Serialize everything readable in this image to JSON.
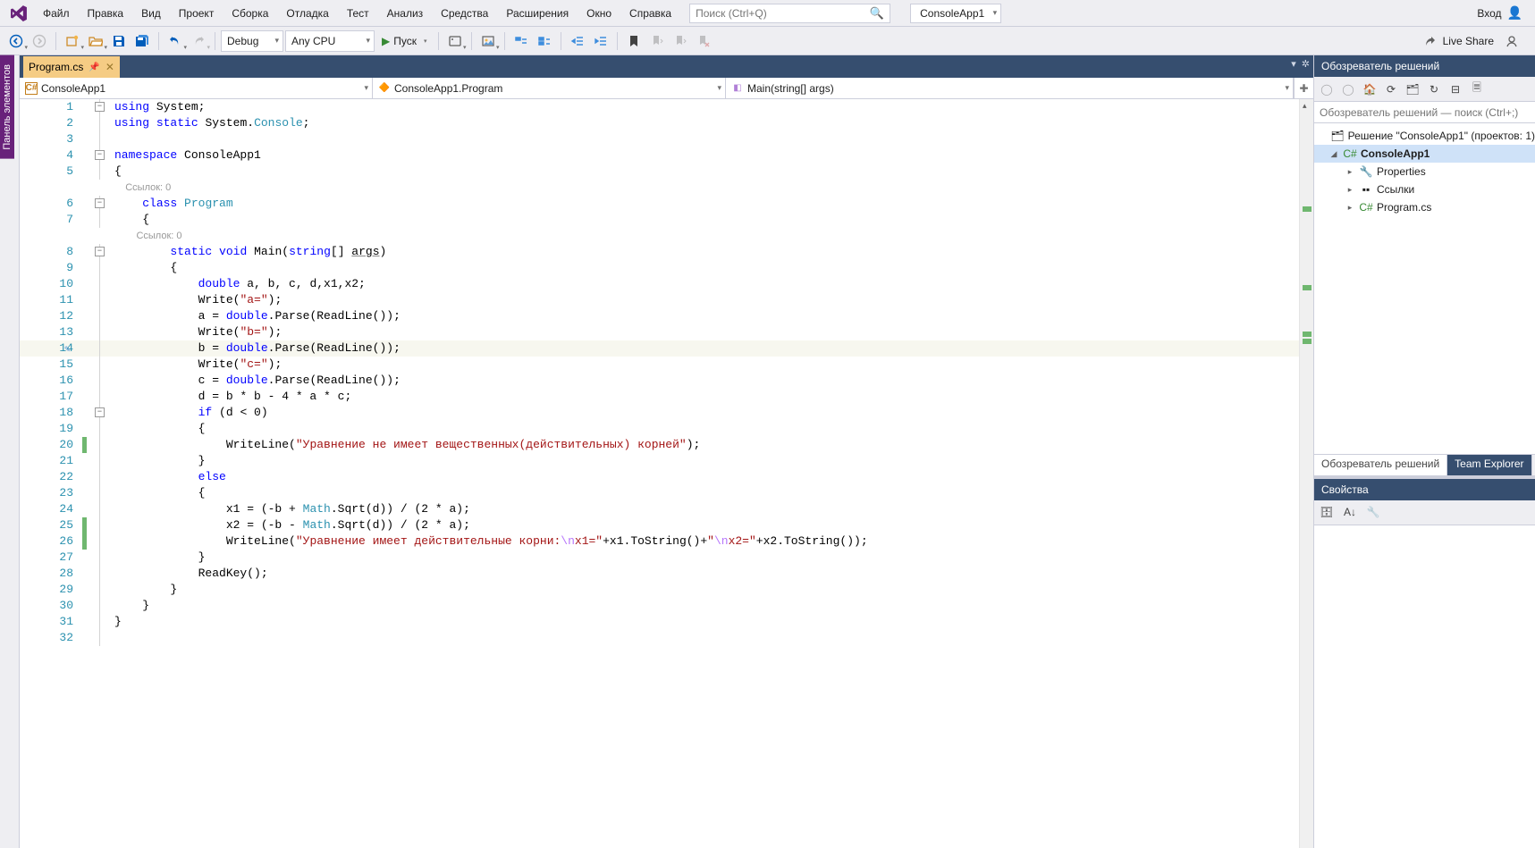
{
  "menubar": {
    "items": [
      "Файл",
      "Правка",
      "Вид",
      "Проект",
      "Сборка",
      "Отладка",
      "Тест",
      "Анализ",
      "Средства",
      "Расширения",
      "Окно",
      "Справка"
    ],
    "search_placeholder": "Поиск (Ctrl+Q)",
    "project_chip": "ConsoleApp1",
    "login": "Вход"
  },
  "toolbar": {
    "config": "Debug",
    "platform": "Any CPU",
    "start": "Пуск",
    "liveshare": "Live Share"
  },
  "left_panel": {
    "tab": "Панель элементов"
  },
  "document": {
    "tab": "Program.cs",
    "nav_project": "ConsoleApp1",
    "nav_class": "ConsoleApp1.Program",
    "nav_member": "Main(string[] args)"
  },
  "codelens": {
    "refs": "Ссылок: 0"
  },
  "code_lines": [
    {
      "n": 1,
      "fold": "-",
      "html": "<span class='kw'>using</span> System;"
    },
    {
      "n": 2,
      "html": "<span class='kw'>using</span> <span class='kw'>static</span> System.<span class='type'>Console</span>;"
    },
    {
      "n": 3,
      "html": ""
    },
    {
      "n": 4,
      "fold": "-",
      "html": "<span class='kw'>namespace</span> ConsoleApp1"
    },
    {
      "n": 5,
      "html": "{"
    },
    {
      "codelens": true,
      "indent": "    ",
      "key": "codelens.refs"
    },
    {
      "n": 6,
      "fold": "-",
      "html": "    <span class='kw'>class</span> <span class='type'>Program</span>"
    },
    {
      "n": 7,
      "html": "    {"
    },
    {
      "codelens": true,
      "indent": "        ",
      "key": "codelens.refs"
    },
    {
      "n": 8,
      "fold": "-",
      "html": "        <span class='kw'>static</span> <span class='kw'>void</span> Main(<span class='kw'>string</span>[] <u class='args'>args</u>)"
    },
    {
      "n": 9,
      "html": "        {"
    },
    {
      "n": 10,
      "html": "            <span class='kw'>double</span> a, b, c, d,x1,x2;"
    },
    {
      "n": 11,
      "html": "            Write(<span class='str'>\"a=\"</span>);"
    },
    {
      "n": 12,
      "html": "            a = <span class='kw'>double</span>.Parse(ReadLine());"
    },
    {
      "n": 13,
      "html": "            Write(<span class='str'>\"b=\"</span>);"
    },
    {
      "n": 14,
      "current": true,
      "edit": true,
      "html": "            b = <span class='kw'>double</span>.Parse(ReadLine());"
    },
    {
      "n": 15,
      "html": "            Write(<span class='str'>\"c=\"</span>);"
    },
    {
      "n": 16,
      "html": "            c = <span class='kw'>double</span>.Parse(ReadLine());"
    },
    {
      "n": 17,
      "html": "            d = b * b - 4 * a * c;"
    },
    {
      "n": 18,
      "fold": "-",
      "html": "            <span class='kw'>if</span> (d &lt; 0)"
    },
    {
      "n": 19,
      "html": "            {"
    },
    {
      "n": 20,
      "green": true,
      "html": "                WriteLine(<span class='str'>\"Уравнение не имеет вещественных(действительных) корней\"</span>);"
    },
    {
      "n": 21,
      "html": "            }"
    },
    {
      "n": 22,
      "html": "            <span class='kw'>else</span>"
    },
    {
      "n": 23,
      "html": "            {"
    },
    {
      "n": 24,
      "html": "                x1 = (-b + <span class='type'>Math</span>.Sqrt(d)) / (2 * a);"
    },
    {
      "n": 25,
      "green": true,
      "html": "                x2 = (-b - <span class='type'>Math</span>.Sqrt(d)) / (2 * a);"
    },
    {
      "n": 26,
      "green": true,
      "html": "                WriteLine(<span class='str'>\"Уравнение имеет действительные корни:</span><span class='esc'>\\n</span><span class='str'>x1=\"</span>+x1.ToString()+<span class='str'>\"</span><span class='esc'>\\n</span><span class='str'>x2=\"</span>+x2.ToString());"
    },
    {
      "n": 27,
      "html": "            }"
    },
    {
      "n": 28,
      "html": "            ReadKey();"
    },
    {
      "n": 29,
      "html": "        }"
    },
    {
      "n": 30,
      "html": "    }"
    },
    {
      "n": 31,
      "html": "}"
    },
    {
      "n": 32,
      "html": ""
    }
  ],
  "solution_explorer": {
    "title": "Обозреватель решений",
    "search_placeholder": "Обозреватель решений — поиск (Ctrl+;)",
    "solution": "Решение \"ConsoleApp1\" (проектов: 1)",
    "project": "ConsoleApp1",
    "nodes": {
      "properties": "Properties",
      "references": "Ссылки",
      "program": "Program.cs"
    },
    "bottom_tabs": {
      "explorer": "Обозреватель решений",
      "team": "Team Explorer"
    }
  },
  "properties": {
    "title": "Свойства"
  }
}
